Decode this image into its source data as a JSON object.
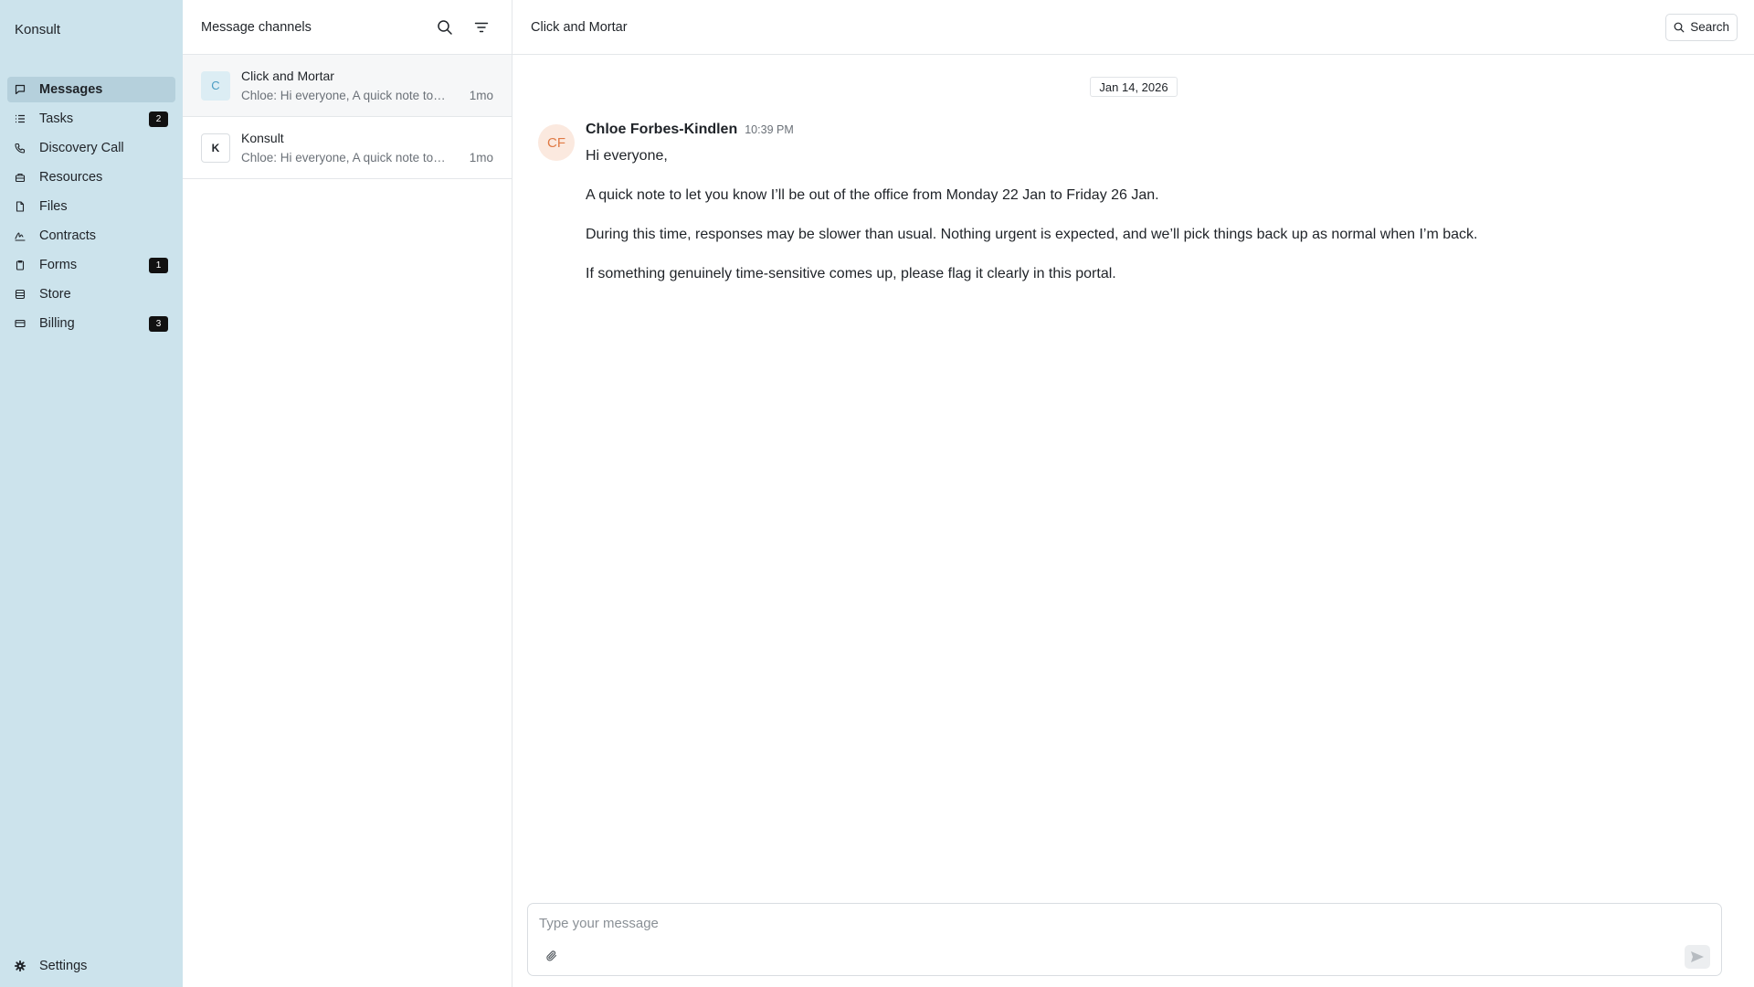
{
  "app": {
    "name": "Konsult"
  },
  "sidebar": {
    "items": [
      {
        "label": "Messages",
        "icon": "message-icon",
        "badge": "",
        "active": true
      },
      {
        "label": "Tasks",
        "icon": "list-icon",
        "badge": "2"
      },
      {
        "label": "Discovery Call",
        "icon": "phone-icon",
        "badge": ""
      },
      {
        "label": "Resources",
        "icon": "briefcase-icon",
        "badge": ""
      },
      {
        "label": "Files",
        "icon": "file-icon",
        "badge": ""
      },
      {
        "label": "Contracts",
        "icon": "signature-icon",
        "badge": ""
      },
      {
        "label": "Forms",
        "icon": "clipboard-icon",
        "badge": "1"
      },
      {
        "label": "Store",
        "icon": "store-icon",
        "badge": ""
      },
      {
        "label": "Billing",
        "icon": "credit-card-icon",
        "badge": "3"
      }
    ],
    "settings_label": "Settings"
  },
  "channels": {
    "title": "Message channels",
    "items": [
      {
        "initial": "C",
        "name": "Click and Mortar",
        "preview": "Chloe: Hi everyone, A quick note to let you know",
        "time": "1mo",
        "active": true
      },
      {
        "initial": "K",
        "name": "Konsult",
        "preview": "Chloe: Hi everyone, A quick note to let you know",
        "time": "1mo"
      }
    ]
  },
  "main": {
    "title": "Click and Mortar",
    "search_label": "Search",
    "date": "Jan 14, 2026",
    "message": {
      "initials": "CF",
      "author": "Chloe Forbes-Kindlen",
      "time": "10:39 PM",
      "lines": [
        "Hi everyone,",
        "A quick note to let you know I’ll be out of the office from Monday 22 Jan to Friday 26 Jan.",
        "During this time, responses may be slower than usual. Nothing urgent is expected, and we’ll pick things back up as normal when I’m back.",
        "If something genuinely time-sensitive comes up, please flag it clearly in this portal."
      ]
    },
    "composer": {
      "placeholder": "Type your message",
      "value": ""
    }
  },
  "colors": {
    "sidebar_bg": "#cce3ec",
    "sidebar_active": "#b5d0dc",
    "badge_bg": "#111111",
    "author_avatar_bg": "#fbe9df",
    "author_avatar_fg": "#e07a45"
  }
}
